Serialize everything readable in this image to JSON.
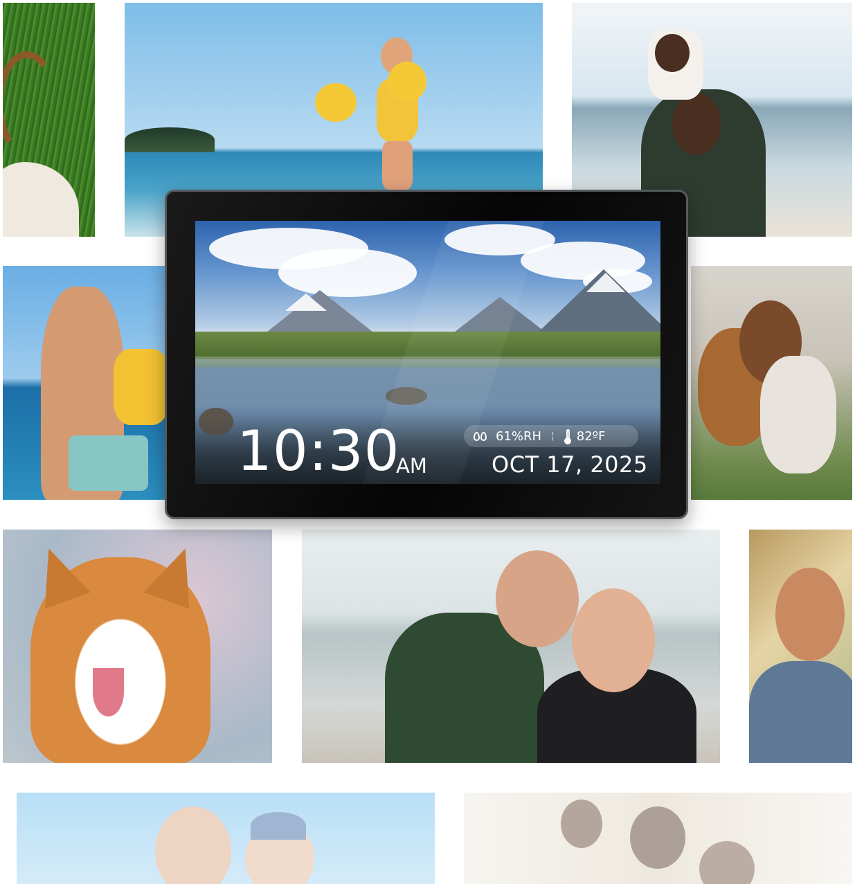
{
  "photo_tiles": [
    {
      "name": "grass-portrait",
      "faded": false
    },
    {
      "name": "girl-at-beach",
      "faded": false
    },
    {
      "name": "father-with-baby",
      "faded": false
    },
    {
      "name": "man-holding-son",
      "faded": false
    },
    {
      "name": "mother-daughter-dog",
      "faded": false
    },
    {
      "name": "corgi",
      "faded": false
    },
    {
      "name": "elderly-couple",
      "faded": false
    },
    {
      "name": "smiling-man",
      "faded": false
    },
    {
      "name": "group-selfie",
      "faded": true
    },
    {
      "name": "family-playing",
      "faded": true
    }
  ],
  "device": {
    "screen_scene": "mountain-lake",
    "clock": {
      "time": "10:30",
      "ampm": "AM",
      "date": "OCT 17, 2025"
    },
    "weather": {
      "humidity": "61%RH",
      "separator": "¦",
      "temperature": "82ºF",
      "humidity_icon": "humidity-drops-icon",
      "temperature_icon": "thermometer-icon"
    }
  },
  "colors": {
    "background": "#ffffff",
    "device_bezel": "#0a0a0a",
    "clock_text": "#ffffff"
  }
}
